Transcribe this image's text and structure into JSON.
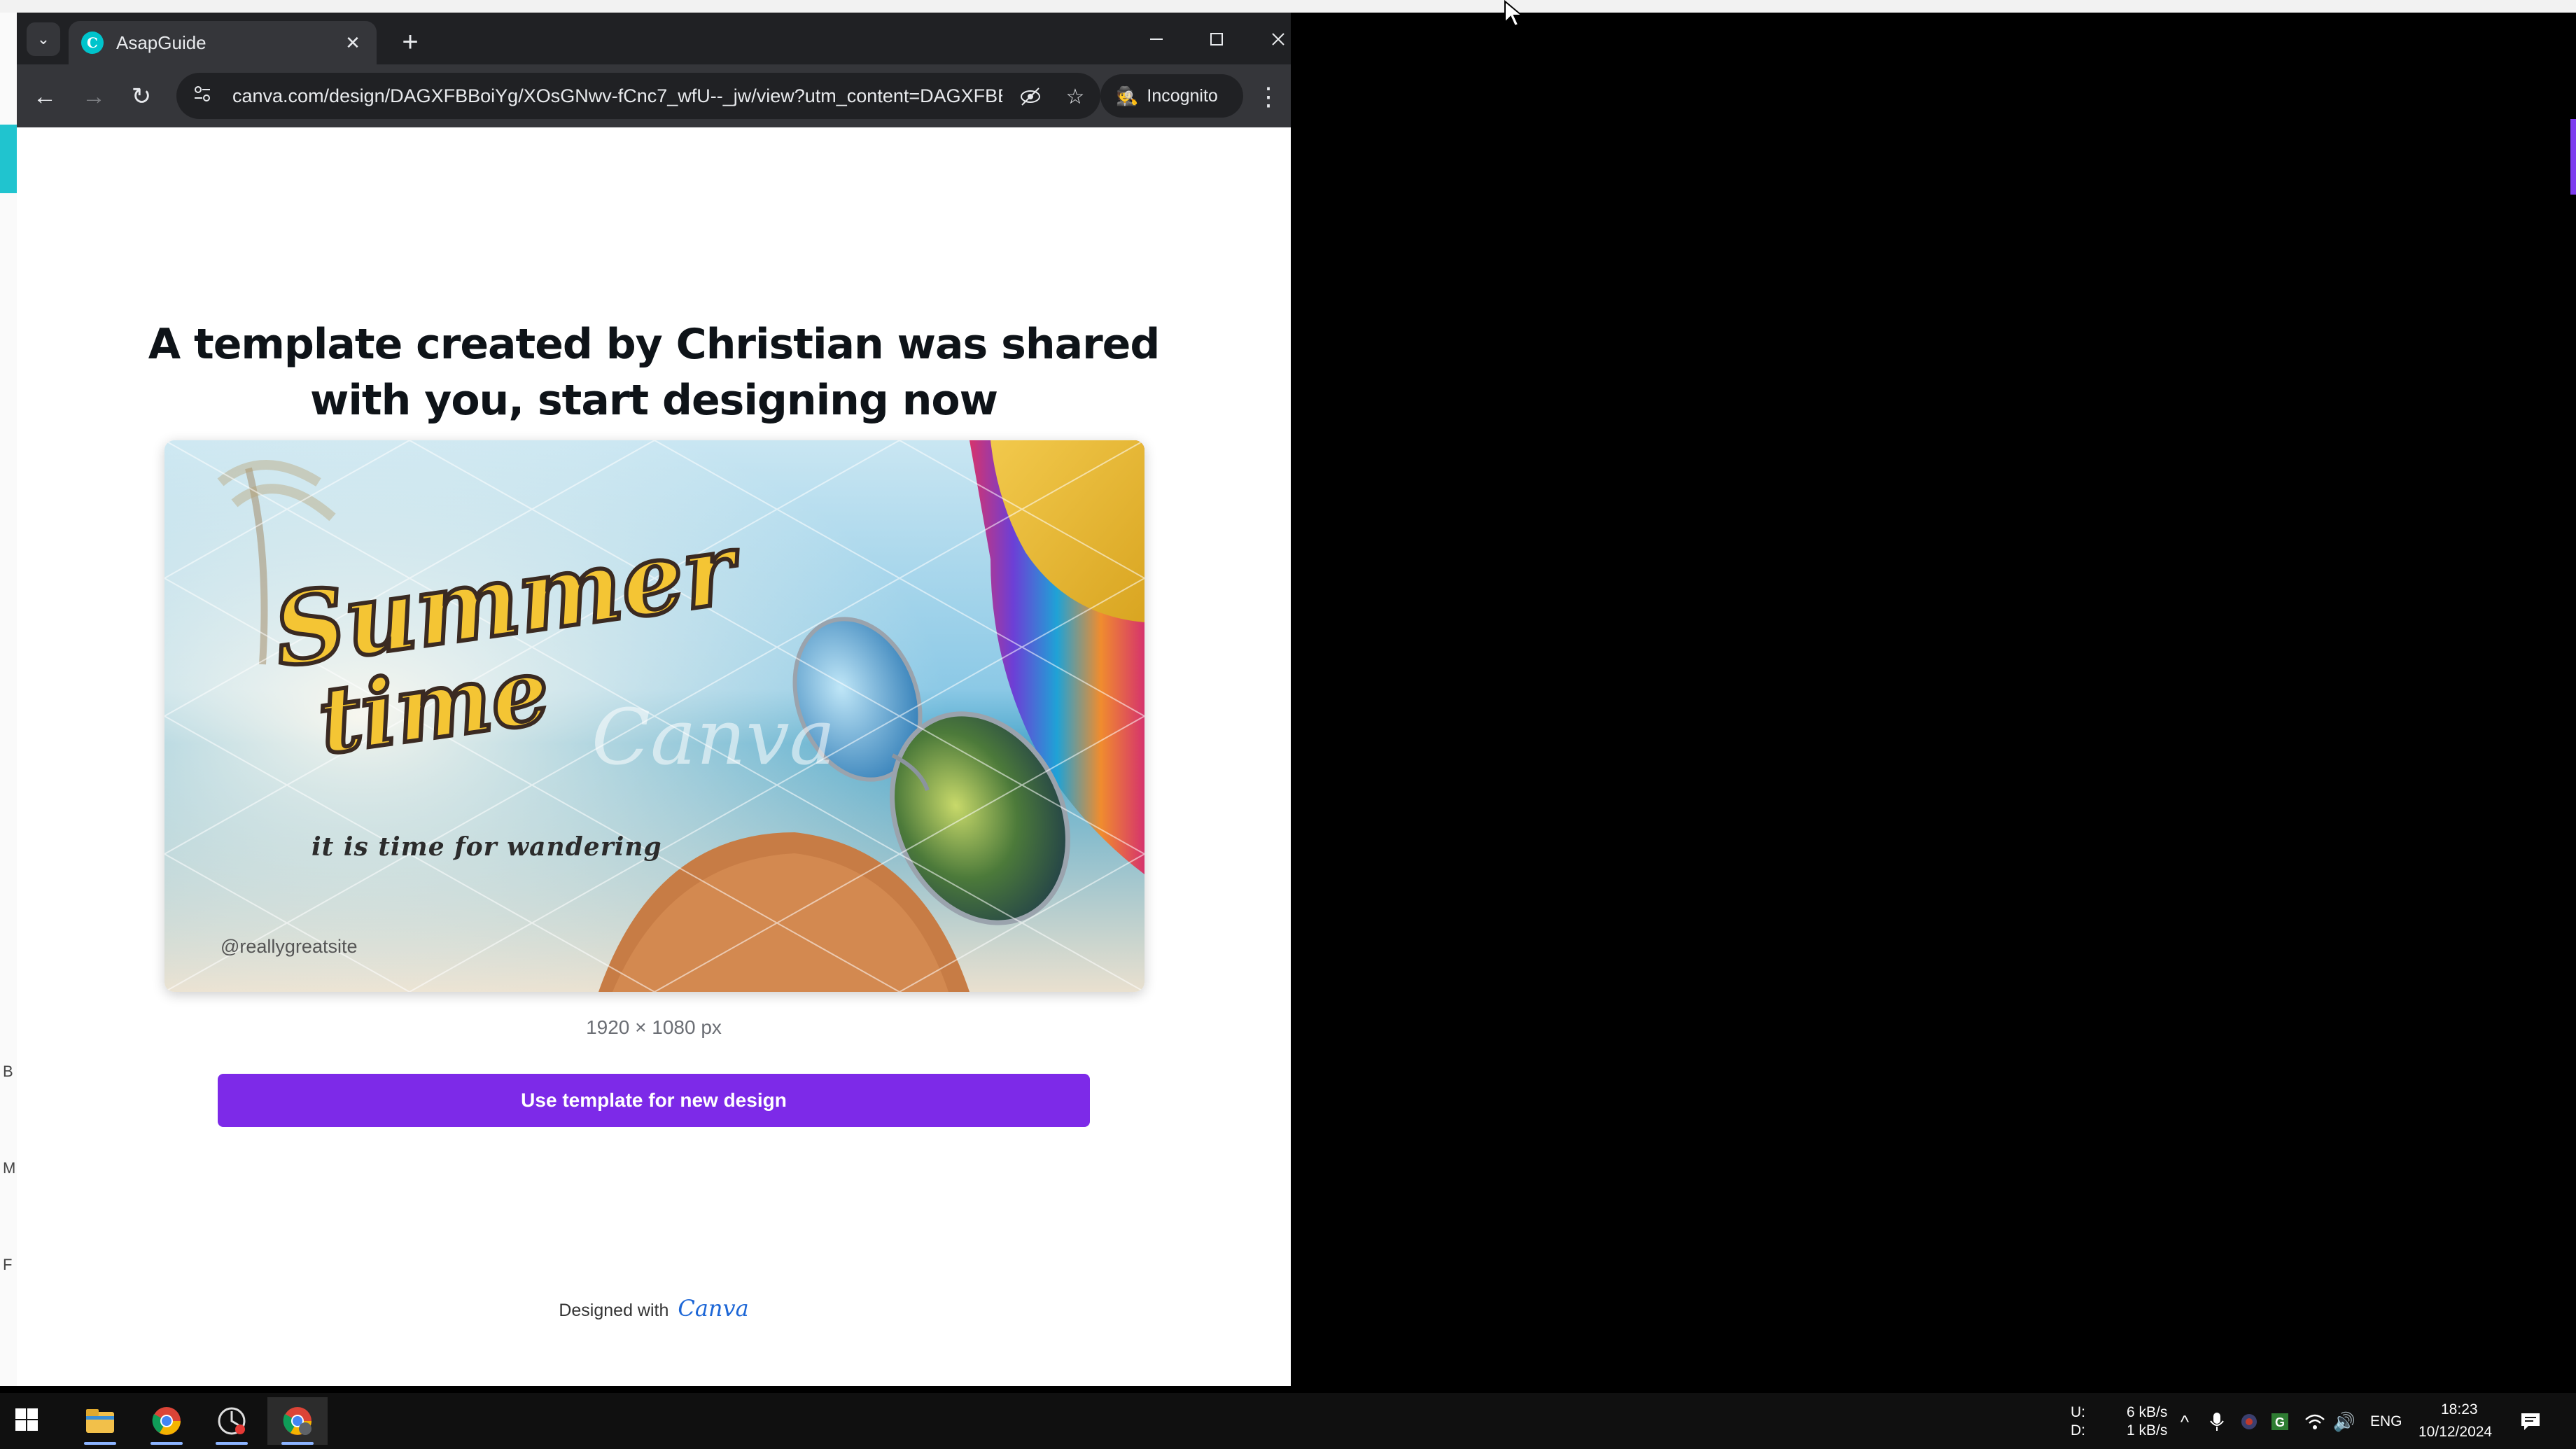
{
  "background": {
    "left_letters": [
      "B",
      "M",
      "F"
    ]
  },
  "browser": {
    "tab": {
      "title": "AsapGuide",
      "favicon_letter": "C"
    },
    "address": {
      "url": "canva.com/design/DAGXFBBoiYg/XOsGNwv-fCnc7_wfU--_jw/view?utm_content=DAGXFBB..."
    },
    "incognito_label": "Incognito"
  },
  "page": {
    "headline_line1": "A template created by Christian was shared",
    "headline_line2": "with you, start designing now",
    "preview": {
      "title_line1": "Summer",
      "title_line2": "time",
      "tagline": "it is time for wandering",
      "handle": "@reallygreatsite",
      "watermark": "Canva"
    },
    "dimensions": "1920 × 1080 px",
    "cta_label": "Use template for new design",
    "footer_prefix": "Designed with",
    "footer_brand": "Canva"
  },
  "taskbar": {
    "net_upload_label": "U:",
    "net_download_label": "D:",
    "net_upload": "6 kB/s",
    "net_download": "1 kB/s",
    "language": "ENG",
    "time": "18:23",
    "date": "10/12/2024"
  },
  "colors": {
    "cta": "#7d2ae8",
    "browser_frame": "#202124",
    "toolbar": "#35363a",
    "canva_brand": "#00c4cc"
  }
}
